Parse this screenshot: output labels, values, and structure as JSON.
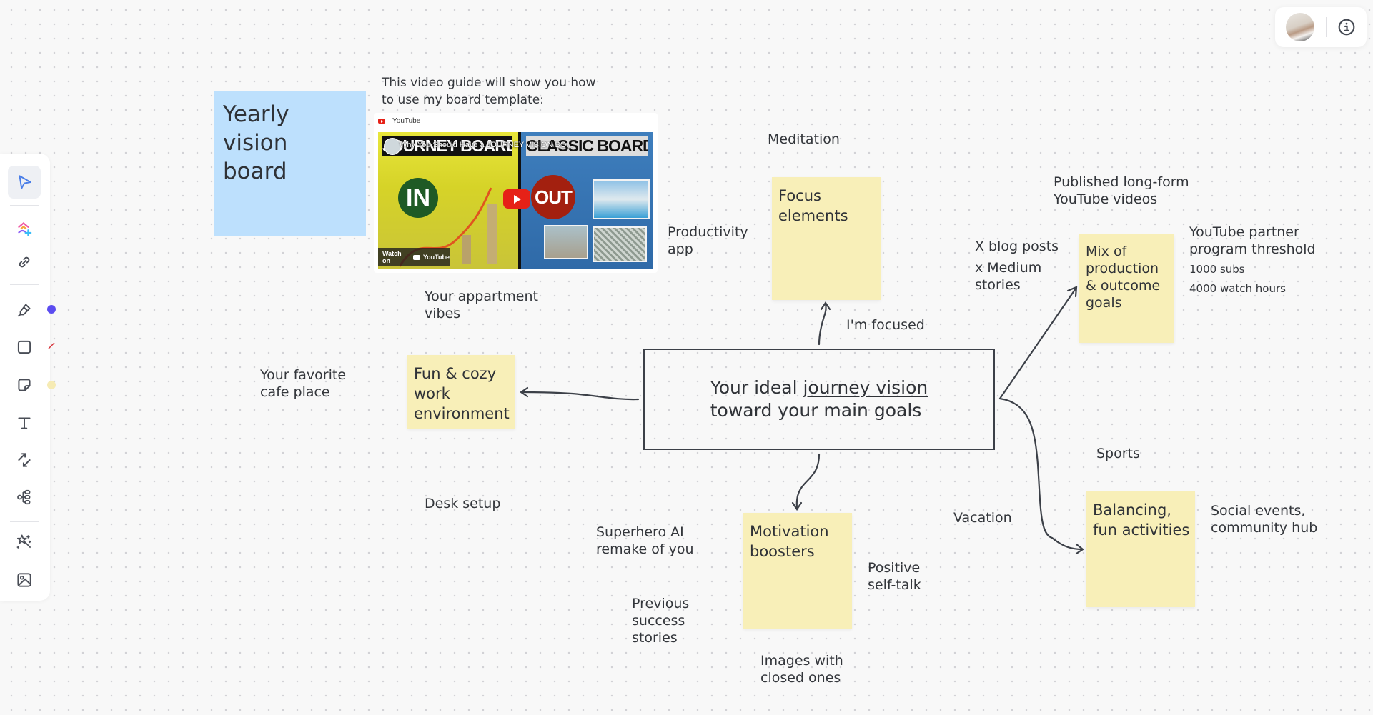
{
  "toolbar": {
    "tools": [
      {
        "name": "select",
        "icon": "pointer-icon",
        "active": true
      },
      {
        "name": "ai-templates",
        "icon": "ai-plus-icon"
      },
      {
        "name": "link",
        "icon": "link-icon"
      },
      {
        "name": "pen",
        "icon": "marker-icon",
        "swatch": "#5b4cf0"
      },
      {
        "name": "shape",
        "icon": "square-icon",
        "swatch": "#d6333a"
      },
      {
        "name": "sticky-note",
        "icon": "sticky-note-icon",
        "swatch": "#f6ebb4"
      },
      {
        "name": "text",
        "icon": "text-icon"
      },
      {
        "name": "connector",
        "icon": "connector-arrows-icon"
      },
      {
        "name": "mind-map",
        "icon": "mind-map-icon"
      },
      {
        "name": "ai-magic",
        "icon": "magic-wand-icon"
      },
      {
        "name": "image",
        "icon": "image-icon"
      }
    ]
  },
  "top_right": {
    "avatar_alt": "User avatar",
    "info_icon": "info-icon"
  },
  "board": {
    "title_note": "Yearly vision board",
    "video_caption": "This video guide will show you how to use my board template:",
    "video": {
      "provider": "YouTube",
      "title": "Why You Should Have a JOURNEY VISION BO...",
      "thumb_left_banner": "JOURNEY BOARD",
      "thumb_right_banner": "CLASSIC BOARD",
      "thumb_in": "IN",
      "thumb_out": "OUT",
      "watch_on": "Watch on",
      "watch_brand": "YouTube"
    },
    "center": {
      "line1_prefix": "Your ideal ",
      "line1_underlined": "journey vision",
      "line2": "toward your main goals"
    },
    "notes": {
      "focus": "Focus elements",
      "fun": "Fun & cozy work environment",
      "motivation": "Motivation boosters",
      "mix": "Mix of production & outcome goals",
      "balancing": "Balancing, fun activities"
    },
    "labels": {
      "meditation": "Meditation",
      "productivity": "Productivity app",
      "focused": "I'm focused",
      "apartment": "Your appartment vibes",
      "cafe": "Your favorite cafe place",
      "desk": "Desk setup",
      "superhero": "Superhero AI remake of you",
      "previous": "Previous success stories",
      "images": "Images with closed ones",
      "positive": "Positive self-talk",
      "vacation": "Vacation",
      "sports": "Sports",
      "social": "Social events, community hub",
      "published": "Published long-form YouTube videos",
      "blog": "X blog posts",
      "medium": "x Medium stories",
      "partner": "YouTube partner program threshold",
      "subs": "1000 subs",
      "watch_hours": "4000 watch hours"
    }
  },
  "colors": {
    "sticky_yellow": "#f8efb8",
    "sticky_blue": "#bde0fd",
    "ink": "#3c4048",
    "accent_blue": "#4a7ee8"
  }
}
